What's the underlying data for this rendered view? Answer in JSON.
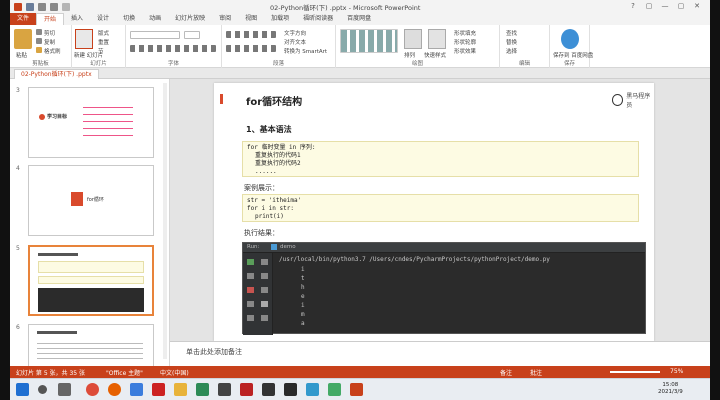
{
  "window": {
    "title": "02-Python循环(下) .pptx - Microsoft PowerPoint",
    "controls": [
      "?",
      "▢",
      "—",
      "▢",
      "✕"
    ]
  },
  "ribbon_tabs": [
    "文件",
    "开始",
    "插入",
    "设计",
    "切换",
    "动画",
    "幻灯片放映",
    "审阅",
    "视图",
    "加载项",
    "福昕阅读器",
    "百度网盘"
  ],
  "ribbon_groups": {
    "clipboard": "剪贴板",
    "slides": "幻灯片",
    "font": "字体",
    "paragraph": "段落",
    "drawing": "绘图",
    "editing": "编辑",
    "save": "保存"
  },
  "ribbon_labels": {
    "paste": "粘贴",
    "new_slide": "新建\n幻灯片",
    "cut": "剪切",
    "copy": "复制",
    "format_painter": "格式刷",
    "layout": "版式",
    "reset": "重置",
    "section": "节",
    "text_direction": "文字方向",
    "align_text": "对齐文本",
    "smartart": "转换为 SmartArt",
    "arrange": "排列",
    "quick_styles": "快速样式",
    "shape_fill": "形状填充",
    "shape_outline": "形状轮廓",
    "shape_effects": "形状效果",
    "find": "查找",
    "replace": "替换",
    "select": "选择",
    "save_to_baidu": "保存到\n百度网盘"
  },
  "document_tab": "02-Python循环(下) .pptx",
  "thumbnails": [
    {
      "num": "3",
      "label": "学习目标"
    },
    {
      "num": "4",
      "label": "for循环"
    },
    {
      "num": "5",
      "label": ""
    },
    {
      "num": "6",
      "label": ""
    }
  ],
  "slide": {
    "title": "for循环结构",
    "logo_text": "黑马程序员",
    "section": "1、基本语法",
    "syntax_lines": [
      "for 临时变量 in 序列:",
      "重复执行的代码1",
      "重复执行的代码2",
      "......"
    ],
    "example_caption": "案例展示：",
    "example_lines": [
      "str = 'itheima'",
      "for i in str:",
      "print(i)"
    ],
    "result_caption": "执行结果：",
    "terminal_tab": "Run:",
    "terminal_file": "demo",
    "terminal_cmd": "/usr/local/bin/python3.7 /Users/cndes/PycharmProjects/pythonProject/demo.py",
    "terminal_output": [
      "i",
      "t",
      "h",
      "e",
      "i",
      "m",
      "a"
    ]
  },
  "notes_placeholder": "单击此处添加备注",
  "status": {
    "slide_info": "幻灯片 第 5 张，共 35 张",
    "theme": "\"Office 主题\"",
    "language": "中文(中国)",
    "notes_btn": "备注",
    "comments_btn": "批注",
    "zoom": "75%"
  },
  "clock": {
    "time": "15:08",
    "date": "2021/3/9"
  },
  "colors": {
    "accent": "#c8411b",
    "code_bg": "#fdfbe3",
    "terminal_bg": "#2b2b2b"
  }
}
